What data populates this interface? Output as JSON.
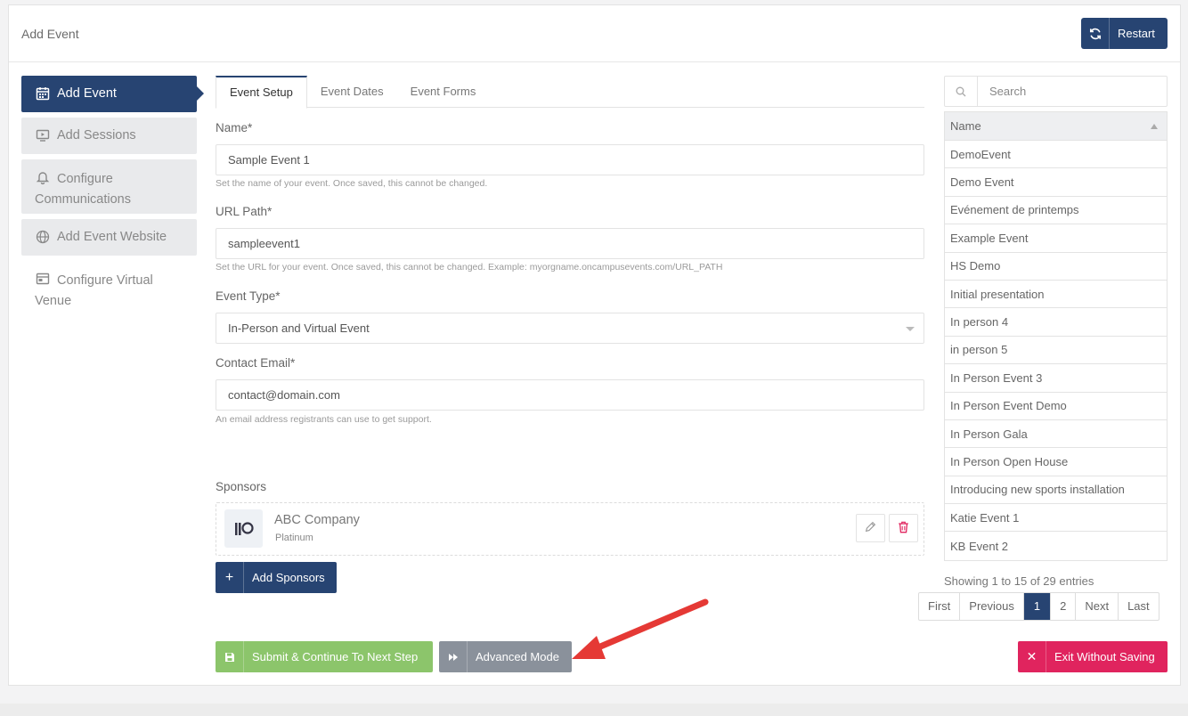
{
  "header": {
    "title": "Add Event",
    "restart_label": "Restart"
  },
  "sidebar": {
    "items": [
      {
        "label": "Add Event",
        "icon": "calendar-icon"
      },
      {
        "label": "Add Sessions",
        "icon": "presentation-icon"
      },
      {
        "label": "Configure Communications",
        "icon": "bell-icon"
      },
      {
        "label": "Add Event Website",
        "icon": "globe-icon"
      },
      {
        "label": "Configure Virtual Venue",
        "icon": "window-icon"
      }
    ]
  },
  "tabs": [
    {
      "label": "Event Setup",
      "active": true
    },
    {
      "label": "Event Dates"
    },
    {
      "label": "Event Forms"
    }
  ],
  "form": {
    "name": {
      "label": "Name*",
      "value": "Sample Event 1",
      "help": "Set the name of your event. Once saved, this cannot be changed."
    },
    "url": {
      "label": "URL Path*",
      "value": "sampleevent1",
      "help": "Set the URL for your event. Once saved, this cannot be changed. Example: myorgname.oncampusevents.com/URL_PATH"
    },
    "event_type": {
      "label": "Event Type*",
      "value": "In-Person and Virtual Event"
    },
    "contact": {
      "label": "Contact Email*",
      "value": "contact@domain.com",
      "help": "An email address registrants can use to get support."
    },
    "sponsors_label": "Sponsors",
    "sponsor": {
      "name": "ABC Company",
      "tier": "Platinum"
    },
    "add_sponsors_label": "Add Sponsors"
  },
  "actions": {
    "submit_label": "Submit & Continue To Next Step",
    "advanced_label": "Advanced Mode",
    "exit_label": "Exit Without Saving"
  },
  "events_table": {
    "search_placeholder": "Search",
    "column": "Name",
    "rows": [
      "DemoEvent",
      "Demo Event",
      "Evénement de printemps",
      "Example Event",
      "HS Demo",
      "Initial presentation",
      "In person 4",
      "in person 5",
      "In Person Event 3",
      "In Person Event Demo",
      "In Person Gala",
      "In Person Open House",
      "Introducing new sports installation",
      "Katie Event 1",
      "KB Event 2"
    ],
    "entries_text": "Showing 1 to 15 of 29 entries",
    "pagination": [
      "First",
      "Previous",
      "1",
      "2",
      "Next",
      "Last"
    ],
    "current_page": "1"
  },
  "colors": {
    "primary": "#274472",
    "submit": "#8cc56b",
    "advanced": "#8a919b",
    "exit": "#e0245e",
    "annotation_arrow": "#e53935"
  }
}
